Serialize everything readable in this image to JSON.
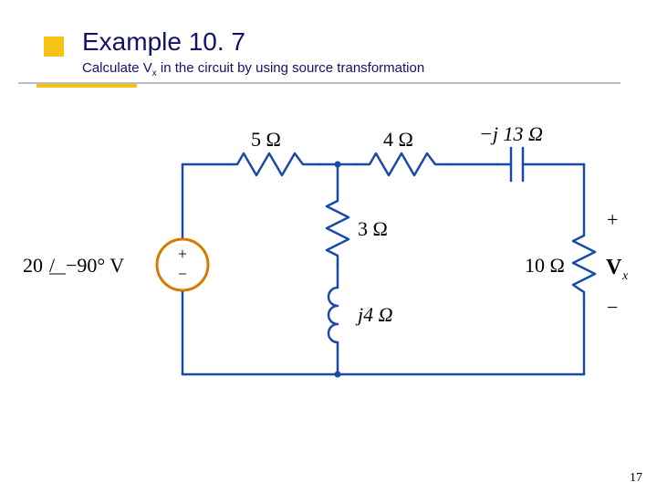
{
  "title": "Example 10. 7",
  "subtitle_prefix": "Calculate V",
  "subtitle_sub": "x",
  "subtitle_suffix": " in the circuit by using source transformation",
  "page_number": "17",
  "circuit": {
    "source_value": "20",
    "source_angle_prefix": "/",
    "source_angle": "−90° V",
    "source_sign_plus": "+",
    "source_sign_minus": "−",
    "r_5": "5 Ω",
    "r_4": "4 Ω",
    "cap": "−j 13 Ω",
    "r_3": "3 Ω",
    "l_j4": "j4 Ω",
    "r_10": "10 Ω",
    "vx_plus": "+",
    "vx_minus": "−",
    "vx_label": "V",
    "vx_sub": "x"
  }
}
